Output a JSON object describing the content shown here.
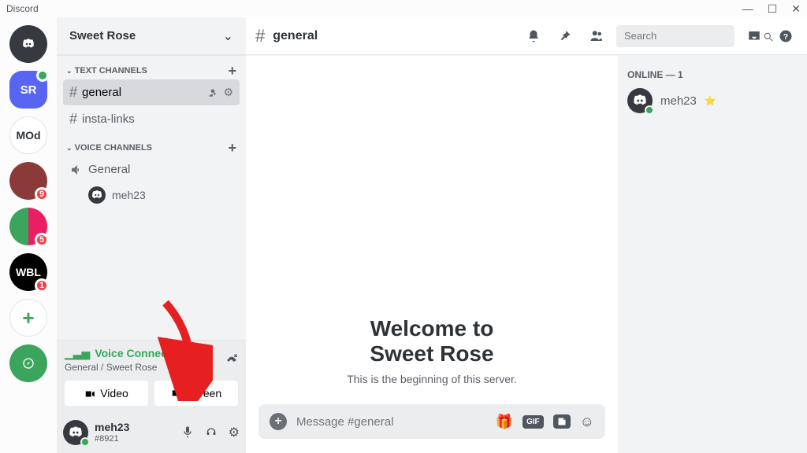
{
  "titlebar": {
    "app_name": "Discord"
  },
  "server_rail": {
    "home_label": "discord",
    "servers": [
      {
        "abbrev": "SR",
        "has_online_badge": true
      },
      {
        "abbrev": "MOd"
      },
      {
        "badge": "9"
      },
      {
        "badge": "5"
      },
      {
        "abbrev": "WBL",
        "badge": "1"
      }
    ]
  },
  "sidebar": {
    "server_name": "Sweet Rose",
    "categories": [
      {
        "label": "Text Channels"
      },
      {
        "label": "Voice Channels"
      }
    ],
    "text_channels": [
      {
        "name": "general",
        "active": true
      },
      {
        "name": "insta-links"
      }
    ],
    "voice_channels": [
      {
        "name": "General",
        "members": [
          {
            "name": "meh23"
          }
        ]
      }
    ]
  },
  "voice_panel": {
    "status": "Voice Connected",
    "subtitle": "General / Sweet Rose",
    "video_label": "Video",
    "screen_label": "Screen"
  },
  "user_footer": {
    "username": "meh23",
    "tag": "#8921"
  },
  "channel_header": {
    "name": "general",
    "search_placeholder": "Search"
  },
  "welcome": {
    "line1": "Welcome to",
    "line2": "Sweet Rose",
    "subtitle": "This is the beginning of this server."
  },
  "composer": {
    "placeholder": "Message #general",
    "gif_label": "GIF"
  },
  "members": {
    "heading": "Online — 1",
    "list": [
      {
        "name": "meh23",
        "owner": true
      }
    ]
  }
}
